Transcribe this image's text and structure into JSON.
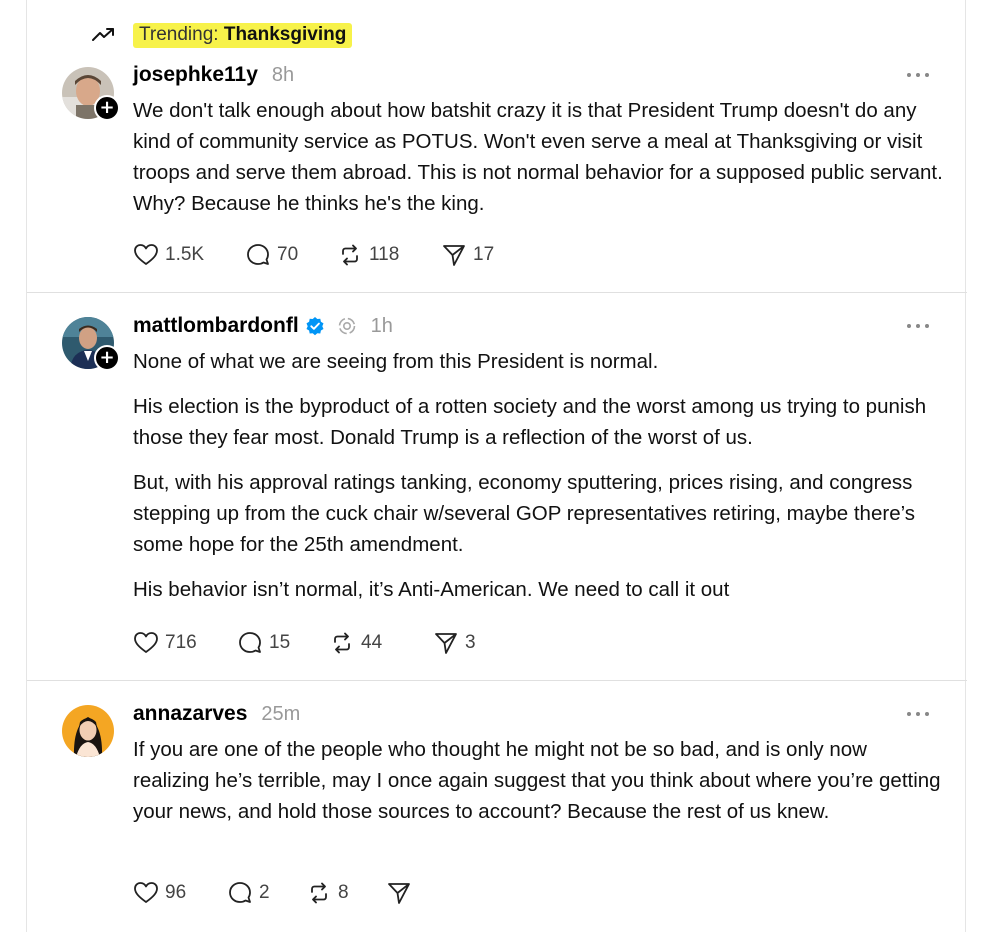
{
  "trending": {
    "prefix": "Trending:",
    "topic": "Thanksgiving"
  },
  "posts": [
    {
      "username": "josephke11y",
      "time": "8h",
      "verified": false,
      "paragraphs": [
        "We don't talk enough about how batshit crazy it is that President Trump doesn't do any kind of community service as POTUS. Won't even serve a meal at Thanksgiving or visit troops and serve them abroad. This is not normal behavior for a supposed public servant. Why? Because he thinks he's the king."
      ],
      "likes": "1.5K",
      "replies": "70",
      "reposts": "118",
      "shares": "17"
    },
    {
      "username": "mattlombardonfl",
      "time": "1h",
      "verified": true,
      "paragraphs": [
        "None of what we are seeing from this President is normal.",
        "His election is the byproduct of a rotten society and the worst among us trying to punish those they fear most. Donald Trump is a reflection of the worst of us.",
        "But, with his approval ratings tanking, economy sputtering, prices rising, and congress stepping up from the cuck chair w/several GOP representatives retiring, maybe there’s some hope for the 25th amendment.",
        "His behavior isn’t normal, it’s Anti-American. We need to call it out"
      ],
      "likes": "716",
      "replies": "15",
      "reposts": "44",
      "shares": "3"
    },
    {
      "username": "annazarves",
      "time": "25m",
      "verified": false,
      "paragraphs": [
        "If you are one of the people who thought he might not be so bad, and is only now realizing he’s terrible, may I once again suggest that you think about where you’re getting your news, and hold those sources to account? Because the rest of us knew."
      ],
      "likes": "96",
      "replies": "2",
      "reposts": "8",
      "shares": ""
    }
  ],
  "icons": {
    "trend": "trending-up-icon",
    "like": "heart-icon",
    "reply": "speech-bubble-icon",
    "repost": "repost-icon",
    "share": "paper-plane-icon",
    "more": "more-dots-icon",
    "follow": "plus-icon",
    "verified": "verified-badge-icon"
  },
  "colors": {
    "trending_highlight": "#f7f24a",
    "verified_blue": "#0095f6",
    "muted_text": "#999999"
  },
  "follow_symbol": "+"
}
